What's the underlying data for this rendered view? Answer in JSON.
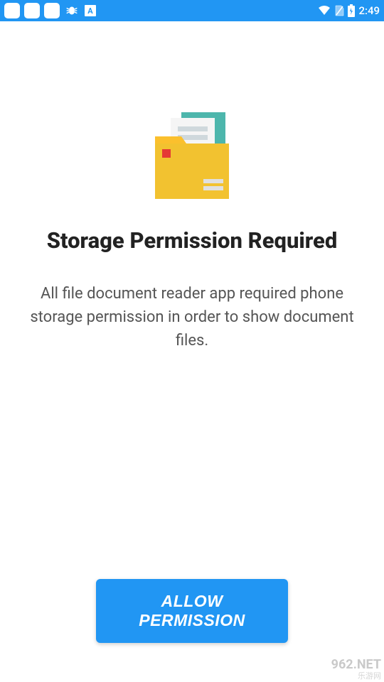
{
  "statusbar": {
    "time": "2:49"
  },
  "content": {
    "heading": "Storage Permission Required",
    "description": "All file document reader app required phone storage permission in order to show  document files."
  },
  "actions": {
    "allow_label": "ALLOW PERMISSION"
  },
  "watermark": {
    "domain": "962.NET",
    "tagline": "乐游网"
  }
}
